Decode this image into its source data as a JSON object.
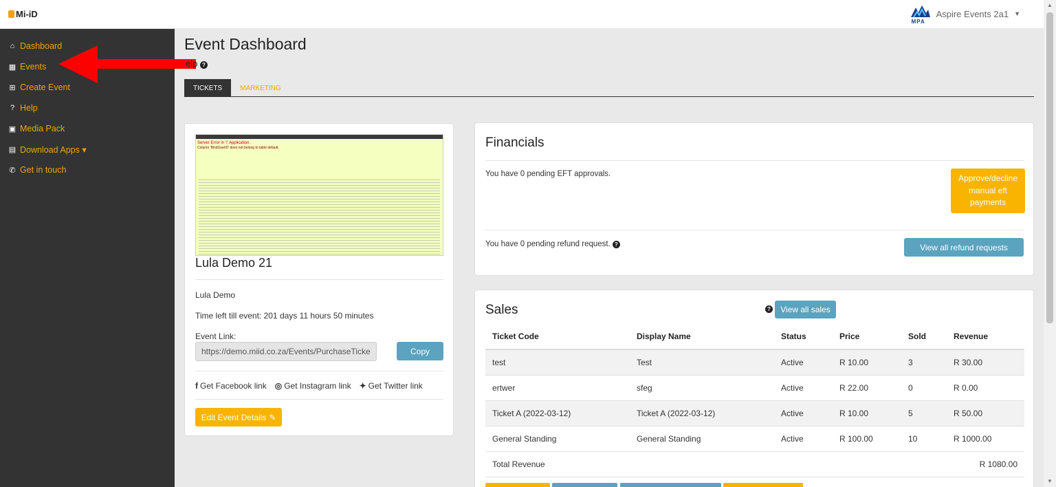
{
  "app": {
    "logo": "Mi-iD",
    "account": "Aspire Events 2a1",
    "account_logo": "MPA"
  },
  "sidebar": {
    "items": [
      {
        "label": "Dashboard",
        "icon": "home-icon"
      },
      {
        "label": "Events",
        "icon": "calendar-icon"
      },
      {
        "label": "Create Event",
        "icon": "plus-square-icon"
      },
      {
        "label": "Help",
        "icon": "question-circle-icon"
      },
      {
        "label": "Media Pack",
        "icon": "images-icon"
      },
      {
        "label": "Download Apps ▾",
        "icon": "file-download-icon"
      },
      {
        "label": "Get in touch",
        "icon": "phone-icon"
      }
    ]
  },
  "page": {
    "title": "Event Dashboard",
    "help": "elp",
    "tabs": [
      "TICKETS",
      "MARKETING"
    ]
  },
  "event": {
    "screenshot_error": "Server Error in '/' Application.",
    "screenshot_error2": "Column 'BindUserID' does not belong to table default.",
    "name": "Lula Demo 21",
    "organiser": "Lula Demo",
    "time_left": "Time left till event: 201 days 11 hours 50 minutes",
    "link_label": "Event Link:",
    "link": "https://demo.miid.co.za/Events/PurchaseTicke",
    "copy": "Copy",
    "facebook": "Get Facebook link",
    "instagram": "Get Instagram link",
    "twitter": "Get Twitter link",
    "edit": "Edit Event Details"
  },
  "financials": {
    "title": "Financials",
    "eft": "You have 0 pending EFT approvals.",
    "approve": "Approve/decline manual eft payments",
    "refund": "You have 0 pending refund request.",
    "view_refunds": "View all refund requests"
  },
  "sales": {
    "title": "Sales",
    "view_all": "View all sales",
    "columns": [
      "Ticket Code",
      "Display Name",
      "Status",
      "Price",
      "Sold",
      "Revenue"
    ],
    "rows": [
      [
        "test",
        "Test",
        "Active",
        "R 10.00",
        "3",
        "R 30.00"
      ],
      [
        "ertwer",
        "sfeg",
        "Active",
        "R 22.00",
        "0",
        "R 0.00"
      ],
      [
        "Ticket A (2022-03-12)",
        "Ticket A (2022-03-12)",
        "Active",
        "R 10.00",
        "5",
        "R 50.00"
      ],
      [
        "General Standing",
        "General Standing",
        "Active",
        "R 100.00",
        "10",
        "R 1000.00"
      ]
    ],
    "total_label": "Total Revenue",
    "total": "R 1080.00"
  },
  "colors": {
    "accent": "#f0a500",
    "sidebar": "#333333",
    "button_blue": "#5ba3bf",
    "button_yellow": "#f8b400",
    "arrow": "#ff0000"
  }
}
